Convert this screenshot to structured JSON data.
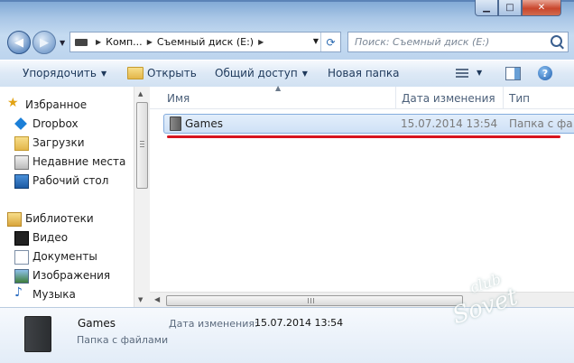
{
  "address": {
    "crumbs": [
      "Комп...",
      "Съемный диск (E:)"
    ]
  },
  "search": {
    "placeholder": "Поиск: Съемный диск (E:)"
  },
  "toolbar": {
    "organize": "Упорядочить",
    "open": "Открыть",
    "share": "Общий доступ",
    "new_folder": "Новая папка"
  },
  "navpane": {
    "favorites": "Избранное",
    "fav_items": [
      "Dropbox",
      "Загрузки",
      "Недавние места",
      "Рабочий стол"
    ],
    "libraries": "Библиотеки",
    "lib_items": [
      "Видео",
      "Документы",
      "Изображения",
      "Музыка"
    ]
  },
  "columns": {
    "name": "Имя",
    "date": "Дата изменения",
    "type": "Тип"
  },
  "files": [
    {
      "name": "Games",
      "date": "15.07.2014 13:54",
      "type": "Папка с фа"
    }
  ],
  "details": {
    "name": "Games",
    "type": "Папка с файлами",
    "date_label": "Дата изменения:",
    "date_value": "15.07.2014 13:54"
  },
  "watermark": {
    "line1": "club",
    "line2": "Sovet"
  },
  "colors": {
    "highlight_line": "#d7141f",
    "selection": "#cfe1f6"
  }
}
